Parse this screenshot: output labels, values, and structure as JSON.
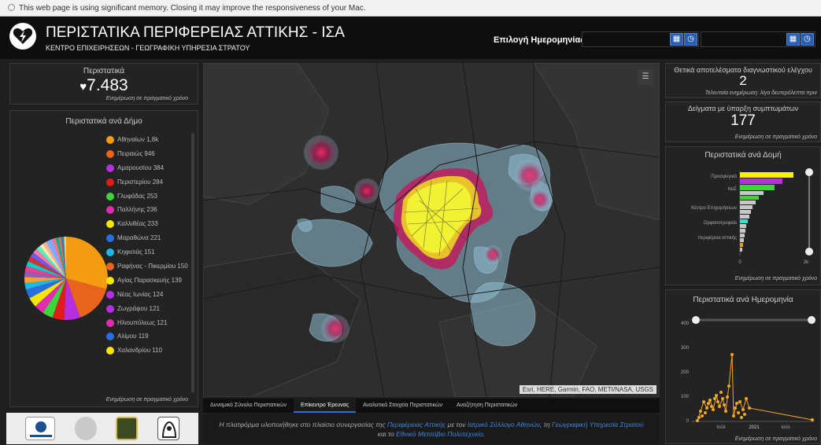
{
  "browser_notice": "This web page is using significant memory. Closing it may improve the responsiveness of your Mac.",
  "header": {
    "title": "ΠΕΡΙΣΤΑΤΙΚΑ ΠΕΡΙΦΕΡΕΙΑΣ ΑΤΤΙΚΗΣ - ΙΣΑ",
    "subtitle": "ΚΕΝΤΡΟ ΕΠΙΧΕΙΡΗΣΕΩΝ - ΓΕΩΓΡΑΦΙΚΗ ΥΠΗΡΕΣΙΑ ΣΤΡΑΤΟΥ",
    "date_label": "Επιλογή Ημερομηνίας:"
  },
  "cases": {
    "title": "Περιστατικά",
    "value": "7.483",
    "updated": "Ενημέρωση σε πραγματικό χρόνο"
  },
  "by_municipality": {
    "title": "Περιστατικά ανά Δήμο",
    "updated": "Ενημέρωση σε πραγματικό χρόνο",
    "items": [
      {
        "label": "Αθηναίων 1,8k",
        "color": "#f39c12"
      },
      {
        "label": "Πειραιώς 946",
        "color": "#e8641c"
      },
      {
        "label": "Αμαρουσίου 384",
        "color": "#b52fe0"
      },
      {
        "label": "Περιστερίου 284",
        "color": "#e01c1c"
      },
      {
        "label": "Γλυφάδας 253",
        "color": "#3ed43e"
      },
      {
        "label": "Παλλήνης 236",
        "color": "#e02cb0"
      },
      {
        "label": "Καλλιθέας 233",
        "color": "#f5e60a"
      },
      {
        "label": "Μαραθώνα 221",
        "color": "#2a6fe0"
      },
      {
        "label": "Κηφισιάς 151",
        "color": "#1fb6e8"
      },
      {
        "label": "Ραφήνας - Πικερμίου 150",
        "color": "#e8641c"
      },
      {
        "label": "Αγίας Παρασκευής 139",
        "color": "#f5e60a"
      },
      {
        "label": "Νέας Ιωνίας 124",
        "color": "#b52fe0"
      },
      {
        "label": "Ζωγράφου 121",
        "color": "#b52fe0"
      },
      {
        "label": "Ηλιουπόλεως 121",
        "color": "#e02cb0"
      },
      {
        "label": "Αλίμου 119",
        "color": "#2a6fe0"
      },
      {
        "label": "Χαλανδρίου 110",
        "color": "#f5e60a"
      }
    ]
  },
  "positive": {
    "title": "Θετικά αποτελέσματα διαγνωστικού ελέγχου",
    "value": "2",
    "updated": "Τελευταία ενημέρωση: λίγα δευτερόλεπτα πριν"
  },
  "symptoms": {
    "title": "Δείγματα με ύπαρξη συμπτωμάτων",
    "value": "177",
    "updated": "Ενημέρωση σε πραγματικό χρόνο"
  },
  "by_structure": {
    "title": "Περιστατικά ανά Δομή",
    "updated": "Ενημέρωση σε πραγματικό χρόνο",
    "labels": [
      "Προσφυγικά",
      "ΝαΣ",
      "Κέντρο Επιχειρήσεων",
      "Ορφανοτροφεία",
      "περιφέρεια αττικής"
    ],
    "axis": [
      "0",
      "2k"
    ]
  },
  "by_date": {
    "title": "Περιστατικά ανά Ημερομηνία",
    "updated": "Ενημέρωση σε πραγματικό χρόνο",
    "y_ticks": [
      "400",
      "300",
      "200",
      "100",
      "0"
    ],
    "x_ticks": [
      "Ιούλ",
      "2021",
      "Ιούλ"
    ]
  },
  "map": {
    "attribution": "Esri, HERE, Garmin, FAO, METI/NASA, USGS"
  },
  "tabs": [
    {
      "label": "Δυναμικό Σύνολο Περιστατικών",
      "active": false
    },
    {
      "label": "Επίκεντρο Έρευνας",
      "active": true
    },
    {
      "label": "Αναλυτικά Στοιχεία Περιστατικών",
      "active": false
    },
    {
      "label": "Αναζήτηση Περιστατικών",
      "active": false
    }
  ],
  "footer": {
    "t1": "Η πλατφόρμα υλοποιήθηκε στο πλαίσιο συνεργασίας της ",
    "l1": "Περιφέρειας Αττικής",
    "t2": " με τον ",
    "l2": "Ιατρικό Σύλλογο Αθηνών",
    "t3": ", τη ",
    "l3": "Γεωγραφική Υπηρεσία Στρατού",
    "t4": " και το ",
    "l4": "Εθνικό Μετσόβιο Πολυτεχνείο",
    "t5": "."
  }
}
